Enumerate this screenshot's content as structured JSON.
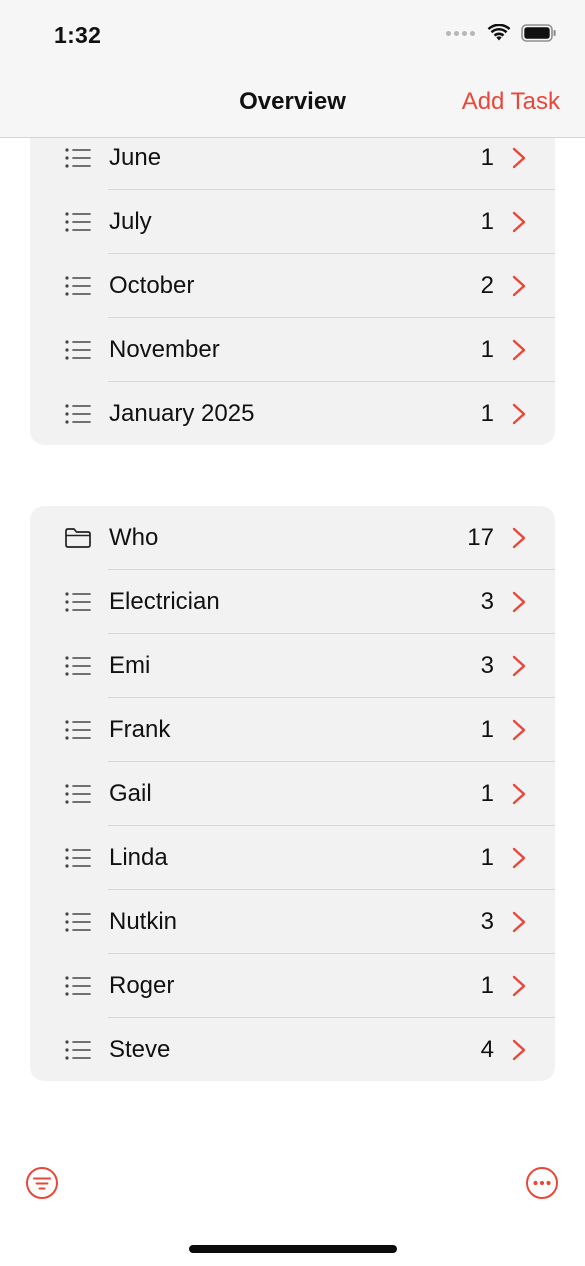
{
  "status_bar": {
    "time": "1:32"
  },
  "nav": {
    "title": "Overview",
    "action": "Add Task"
  },
  "colors": {
    "accent": "#e9473a",
    "group_bg": "#f3f2f2"
  },
  "months_group": {
    "rows": [
      {
        "icon": "list-icon",
        "label": "June",
        "count": "1"
      },
      {
        "icon": "list-icon",
        "label": "July",
        "count": "1"
      },
      {
        "icon": "list-icon",
        "label": "October",
        "count": "2"
      },
      {
        "icon": "list-icon",
        "label": "November",
        "count": "1"
      },
      {
        "icon": "list-icon",
        "label": "January 2025",
        "count": "1"
      }
    ]
  },
  "who_group": {
    "rows": [
      {
        "icon": "folder-icon",
        "label": "Who",
        "count": "17"
      },
      {
        "icon": "list-icon",
        "label": "Electrician",
        "count": "3"
      },
      {
        "icon": "list-icon",
        "label": "Emi",
        "count": "3"
      },
      {
        "icon": "list-icon",
        "label": "Frank",
        "count": "1"
      },
      {
        "icon": "list-icon",
        "label": "Gail",
        "count": "1"
      },
      {
        "icon": "list-icon",
        "label": "Linda",
        "count": "1"
      },
      {
        "icon": "list-icon",
        "label": "Nutkin",
        "count": "3"
      },
      {
        "icon": "list-icon",
        "label": "Roger",
        "count": "1"
      },
      {
        "icon": "list-icon",
        "label": "Steve",
        "count": "4"
      }
    ]
  },
  "toolbar": {
    "left_icon": "filter-icon",
    "right_icon": "more-icon"
  }
}
